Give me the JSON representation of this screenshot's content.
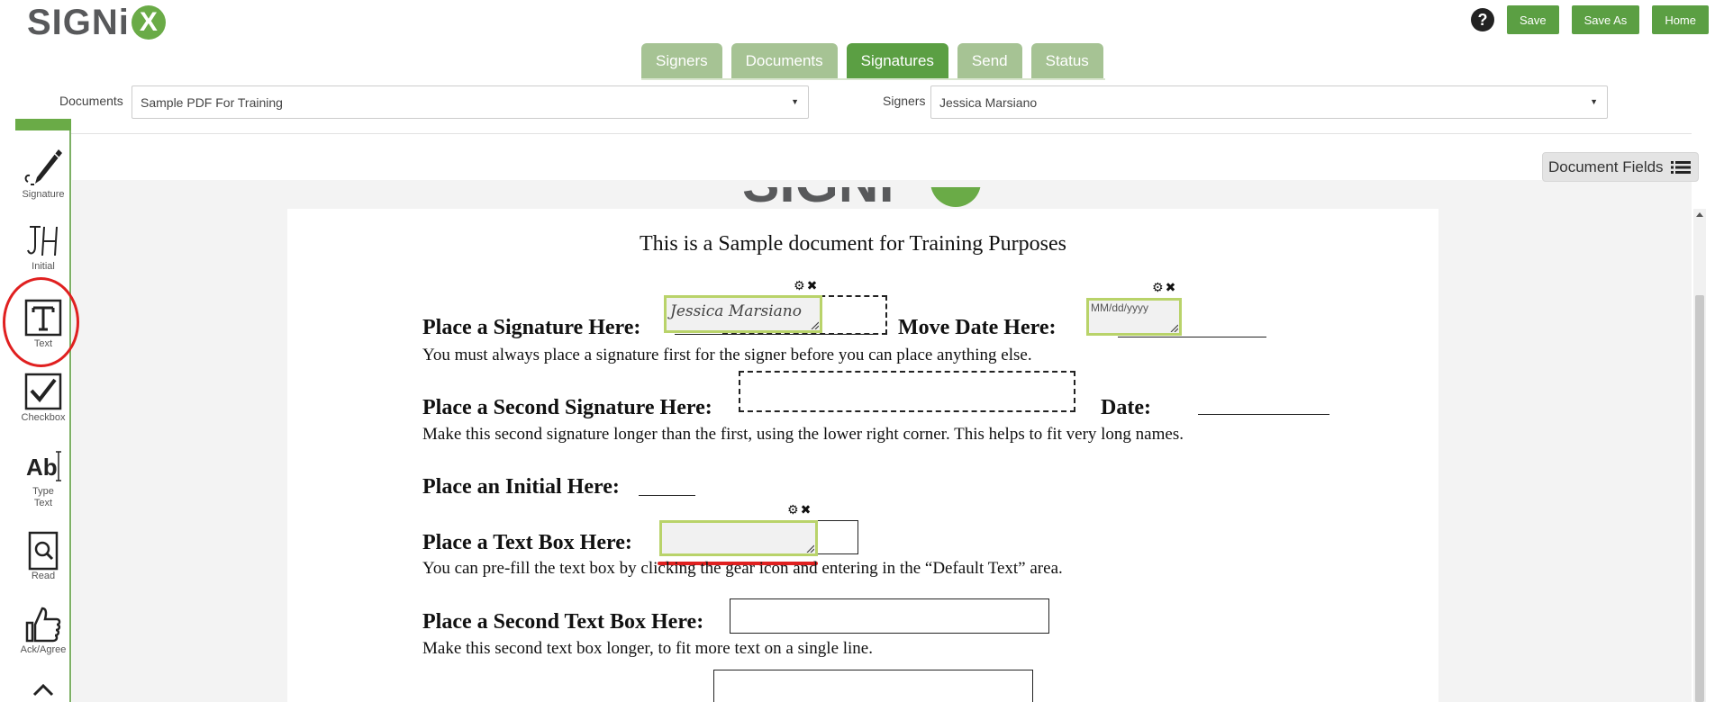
{
  "brand": {
    "logo_text": "SIGNi",
    "logo_x": "X"
  },
  "header": {
    "help_label": "?",
    "save_label": "Save",
    "save_as_label": "Save As",
    "home_label": "Home"
  },
  "tabs": [
    {
      "label": "Signers",
      "active": false
    },
    {
      "label": "Documents",
      "active": false
    },
    {
      "label": "Signatures",
      "active": true
    },
    {
      "label": "Send",
      "active": false
    },
    {
      "label": "Status",
      "active": false
    }
  ],
  "documents_select": {
    "label": "Documents",
    "value": "Sample PDF For Training"
  },
  "signers_select": {
    "label": "Signers",
    "value": "Jessica Marsiano"
  },
  "document_fields_button": {
    "label": "Document Fields"
  },
  "toolbar": {
    "items": [
      {
        "label": "Signature",
        "icon": "pen-icon"
      },
      {
        "label": "Initial",
        "icon": "initial-icon"
      },
      {
        "label": "Text",
        "icon": "text-box-icon"
      },
      {
        "label": "Checkbox",
        "icon": "checkbox-icon"
      },
      {
        "label": "Type Text",
        "label_line1": "Type",
        "label_line2": "Text",
        "icon": "type-text-icon"
      },
      {
        "label": "Read",
        "icon": "magnifier-icon"
      },
      {
        "label": "Ack/Agree",
        "icon": "thumbs-up-icon"
      }
    ],
    "collapse_icon": "chevron-up-icon"
  },
  "document": {
    "title": "This is a Sample document for Training Purposes",
    "sig_label": "Place a Signature Here:",
    "sig_field_value": "Jessica Marsiano",
    "move_date_label": "Move Date Here:",
    "date_placeholder": "MM/dd/yyyy",
    "sig_note": "You must always place a signature first for the signer before you can place anything else.",
    "second_sig_label": "Place a Second Signature Here:",
    "date_label": "Date:",
    "second_sig_note": "Make this second signature longer than the first, using the lower right corner. This helps to fit very long names.",
    "initial_label": "Place an Initial Here:",
    "text_box_label": "Place a Text Box Here:",
    "text_box_note": "You can pre-fill the text box by clicking the gear icon and entering in the “Default Text” area.",
    "second_text_box_label": "Place a Second Text Box Here:",
    "second_text_box_note": "Make this second text box longer, to fit more text on a single line."
  },
  "colors": {
    "brand_green": "#5b9f43",
    "tab_inactive": "#a6c394",
    "field_border": "#b9d36a",
    "highlight_red": "#e02020"
  }
}
